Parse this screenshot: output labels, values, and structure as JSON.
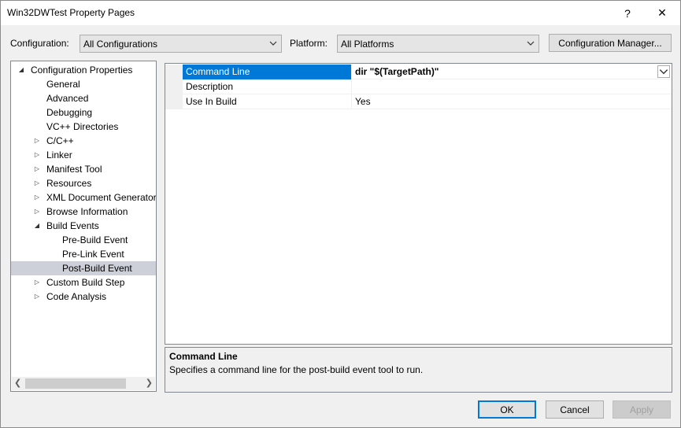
{
  "window": {
    "title": "Win32DWTest Property Pages",
    "help_glyph": "?",
    "close_glyph": "✕"
  },
  "toolbar": {
    "configuration_label": "Configuration:",
    "configuration_value": "All Configurations",
    "platform_label": "Platform:",
    "platform_value": "All Platforms",
    "config_manager_label": "Configuration Manager..."
  },
  "tree": {
    "items": [
      {
        "label": "Configuration Properties",
        "level": 0,
        "expander": "expanded"
      },
      {
        "label": "General",
        "level": 1,
        "expander": "none"
      },
      {
        "label": "Advanced",
        "level": 1,
        "expander": "none"
      },
      {
        "label": "Debugging",
        "level": 1,
        "expander": "none"
      },
      {
        "label": "VC++ Directories",
        "level": 1,
        "expander": "none"
      },
      {
        "label": "C/C++",
        "level": 1,
        "expander": "collapsed"
      },
      {
        "label": "Linker",
        "level": 1,
        "expander": "collapsed"
      },
      {
        "label": "Manifest Tool",
        "level": 1,
        "expander": "collapsed"
      },
      {
        "label": "Resources",
        "level": 1,
        "expander": "collapsed"
      },
      {
        "label": "XML Document Generator",
        "level": 1,
        "expander": "collapsed"
      },
      {
        "label": "Browse Information",
        "level": 1,
        "expander": "collapsed"
      },
      {
        "label": "Build Events",
        "level": 1,
        "expander": "expanded"
      },
      {
        "label": "Pre-Build Event",
        "level": 2,
        "expander": "none"
      },
      {
        "label": "Pre-Link Event",
        "level": 2,
        "expander": "none"
      },
      {
        "label": "Post-Build Event",
        "level": 2,
        "expander": "none",
        "selected": true
      },
      {
        "label": "Custom Build Step",
        "level": 1,
        "expander": "collapsed"
      },
      {
        "label": "Code Analysis",
        "level": 1,
        "expander": "collapsed"
      }
    ]
  },
  "grid": {
    "rows": [
      {
        "name": "Command Line",
        "value": "dir \"$(TargetPath)\"",
        "selected": true
      },
      {
        "name": "Description",
        "value": ""
      },
      {
        "name": "Use In Build",
        "value": "Yes"
      }
    ]
  },
  "description": {
    "title": "Command Line",
    "text": "Specifies a command line for the post-build event tool to run."
  },
  "buttons": {
    "ok": "OK",
    "cancel": "Cancel",
    "apply": "Apply"
  },
  "colors": {
    "accent": "#0078d7",
    "selection_tree": "#cdd0d9"
  }
}
